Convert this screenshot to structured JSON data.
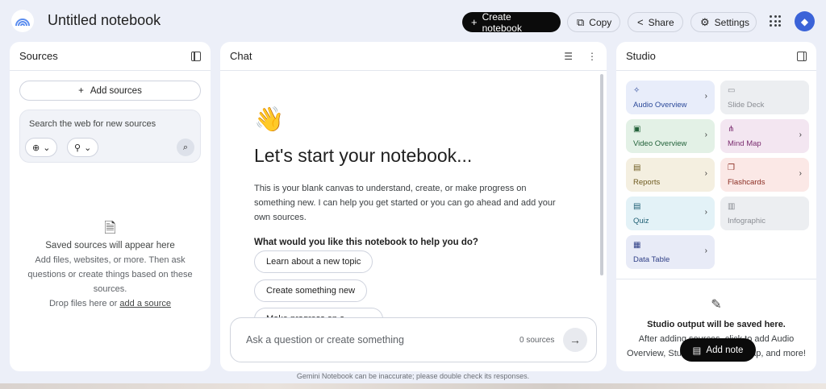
{
  "header": {
    "title": "Untitled notebook",
    "create_label": "Create notebook",
    "copy_label": "Copy",
    "share_label": "Share",
    "settings_label": "Settings"
  },
  "sources": {
    "title": "Sources",
    "add_label": "Add sources",
    "search_placeholder": "Search the web for new sources",
    "empty_title": "Saved sources will appear here",
    "empty_desc": "Add files, websites, or more. Then ask questions or create things based on these sources.",
    "drop_text": "Drop files here or ",
    "drop_link": "add a source"
  },
  "chat": {
    "title": "Chat",
    "heading": "Let's start your notebook...",
    "description": "This is your blank canvas to understand, create, or make progress on something new. I can help you get started or you can go ahead and add your own sources.",
    "question": "What would you like this notebook to help you do?",
    "suggestions": [
      "Learn about a new topic",
      "Create something new",
      "Make progress on a project"
    ],
    "input_placeholder": "Ask a question or create something",
    "source_count": "0 sources"
  },
  "studio": {
    "title": "Studio",
    "tiles": [
      {
        "label": "Audio Overview",
        "icon": "✧"
      },
      {
        "label": "Slide Deck",
        "icon": "▭"
      },
      {
        "label": "Video Overview",
        "icon": "▣"
      },
      {
        "label": "Mind Map",
        "icon": "⋔"
      },
      {
        "label": "Reports",
        "icon": "▤"
      },
      {
        "label": "Flashcards",
        "icon": "❐"
      },
      {
        "label": "Quiz",
        "icon": "▤"
      },
      {
        "label": "Infographic",
        "icon": "▥"
      },
      {
        "label": "Data Table",
        "icon": "▦"
      }
    ],
    "empty_title": "Studio output will be saved here.",
    "empty_desc": "After adding sources, click to add Audio Overview, Study Guide, Mind Map, and more!",
    "add_note_label": "Add note"
  },
  "footer": {
    "disclaimer": "Gemini Notebook can be inaccurate; please double check its responses."
  },
  "colors": {
    "background": "#eceff8",
    "primary_button": "#0b0b0b",
    "audio_tile": "#e8edfa",
    "video_tile": "#e3f1e6",
    "mind_map_tile": "#f3e6f1",
    "reports_tile": "#f4efe0",
    "flashcards_tile": "#fbe8e6",
    "quiz_tile": "#e3f2f7",
    "data_table_tile": "#e8ebf7",
    "avatar": "#3b63d8"
  }
}
